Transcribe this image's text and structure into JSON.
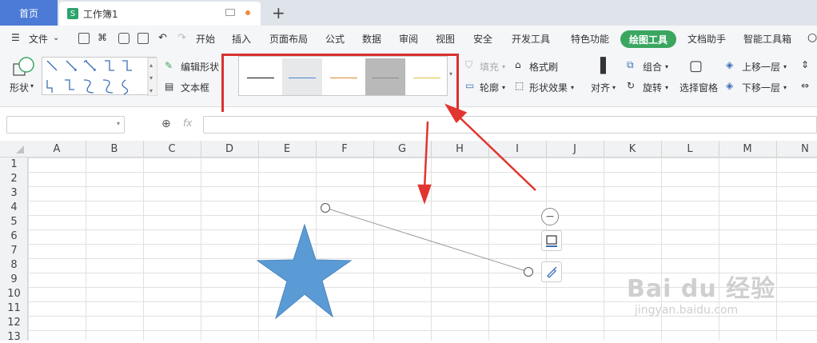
{
  "tabs": {
    "home": "首页",
    "doc": "工作簿1",
    "new_tab": "+"
  },
  "menubar": {
    "file": "文件",
    "items": [
      "开始",
      "插入",
      "页面布局",
      "公式",
      "数据",
      "审阅",
      "视图",
      "安全",
      "开发工具",
      "特色功能"
    ],
    "active": "绘图工具",
    "after": [
      "文档助手",
      "智能工具箱"
    ]
  },
  "ribbon": {
    "shape": "形状",
    "edit_shape": "编辑形状",
    "text_box": "文本框",
    "fill": "填充",
    "format_painter": "格式刷",
    "outline": "轮廓",
    "shape_effects": "形状效果",
    "align": "对齐",
    "group": "组合",
    "rotate": "旋转",
    "selection_pane": "选择窗格",
    "bring_forward": "上移一层",
    "send_backward": "下移一层"
  },
  "line_styles": [
    {
      "color": "#111111"
    },
    {
      "color": "#4a86c8"
    },
    {
      "color": "#d98a3a"
    },
    {
      "color": "#8c8c8c"
    },
    {
      "color": "#e0c040"
    }
  ],
  "formula": {
    "fx": "fx"
  },
  "columns": [
    "A",
    "B",
    "C",
    "D",
    "E",
    "F",
    "G",
    "H",
    "I",
    "J",
    "K",
    "L",
    "M",
    "N"
  ],
  "rows": [
    "1",
    "2",
    "3",
    "4",
    "5",
    "6",
    "7",
    "8",
    "9",
    "10",
    "11",
    "12",
    "13"
  ],
  "colors": {
    "accent_green": "#3aa660",
    "home_blue": "#4b7bd6",
    "highlight_red": "#d9322f",
    "star_blue": "#5b9bd5"
  },
  "watermark": {
    "brand": "Bai du 经验",
    "url": "jingyan.baidu.com"
  }
}
